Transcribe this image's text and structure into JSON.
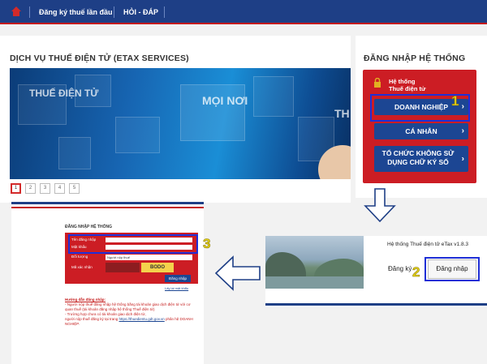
{
  "nav": {
    "register_label": "Đăng ký thuế lần đầu",
    "faq_label": "HỎI - ĐÁP"
  },
  "services": {
    "title": "DỊCH VỤ THUẾ ĐIỆN TỬ (ETAX SERVICES)",
    "banner_text1": "THUẾ ĐIỆN TỬ",
    "banner_text2": "MỌI NƠI",
    "banner_text3": "TH"
  },
  "pagination": [
    "1",
    "2",
    "3",
    "4",
    "5"
  ],
  "login": {
    "title": "ĐĂNG NHẬP HỆ THỐNG",
    "system_label_1": "Hệ thống",
    "system_label_2": "Thuế điện tử",
    "btn_business": "DOANH NGHIỆP",
    "btn_personal": "CÁ NHÂN",
    "btn_org": "TỔ CHỨC KHÔNG SỬ DỤNG CHỮ KÝ SỐ"
  },
  "step_numbers": {
    "one": "1",
    "two": "2",
    "three": "3"
  },
  "small_login": {
    "title": "ĐĂNG NHẬP HỆ THỐNG",
    "username_label": "Tên đăng nhập",
    "password_label": "Mật khẩu",
    "subject_label": "Đối tượng",
    "subject_value": "Người nộp thuế",
    "captcha_label": "Mã xác nhận",
    "captcha_value": "BODO",
    "login_button": "Đăng nhập",
    "forgot": "Lấy lại mật khẩu",
    "guide_title": "Hướng dẫn đăng nhập:",
    "guide_1": "- Người nộp thuế đăng nhập hệ thống bằng tài khoản giao dịch điện tử với cơ quan thuế (tài khoản đăng nhập hệ thống Thuế điện tử)",
    "guide_2": "- Trường hợp chưa có tài khoản giao dịch điện tử,",
    "guide_3": "người nộp thuế đăng ký tại trang",
    "guide_link": "https://thuedientu.gdt.gov.vn",
    "guide_4": "phân hệ DOANH NGHIỆP."
  },
  "etax": {
    "system_title": "Hệ thống Thuế điện tử eTax v1.8.3",
    "register_label": "Đăng ký",
    "login_label": "Đăng nhập"
  },
  "colors": {
    "navy": "#1e3f86",
    "red": "#cc1d24",
    "highlight": "#1f2fd6",
    "number_yellow": "#e6d31a"
  }
}
